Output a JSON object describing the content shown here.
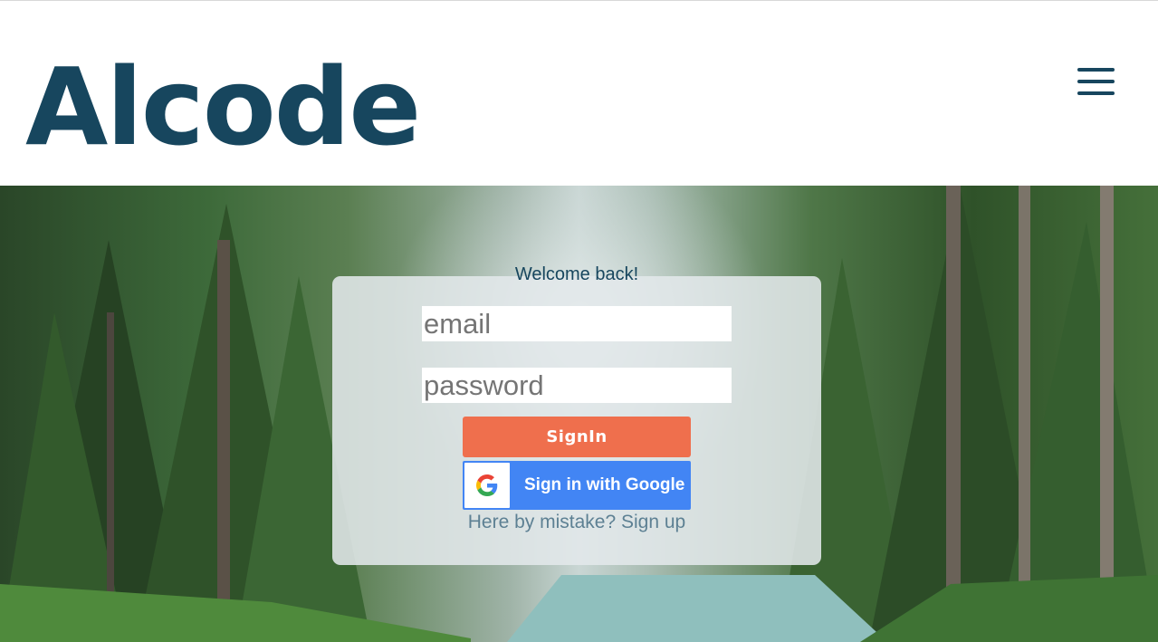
{
  "header": {
    "logo_text": "Alcode"
  },
  "login": {
    "welcome": "Welcome back!",
    "email_placeholder": "email",
    "password_placeholder": "password",
    "signin_label": "SignIn",
    "google_label": "Sign in with Google",
    "signup_link": "Here by mistake? Sign up"
  },
  "colors": {
    "brand": "#17465e",
    "signin_button": "#ef6f4d",
    "google_button": "#4285f4",
    "link": "#5d8093"
  },
  "icons": {
    "menu": "hamburger-menu-icon",
    "google": "google-g-icon"
  },
  "background": {
    "description_image": "forest-lake-photo"
  }
}
